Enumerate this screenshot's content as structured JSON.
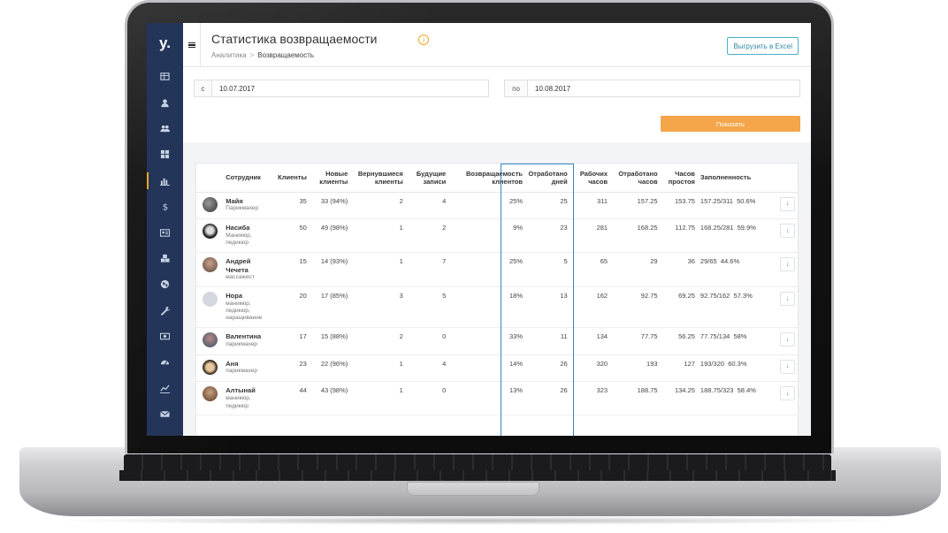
{
  "app": {
    "logo": "y."
  },
  "header": {
    "title": "Статистика возвращаемости",
    "breadcrumb": [
      "Аналитика",
      "Возвращаемость"
    ],
    "breadcrumb_sep": ">",
    "export_button": "Выгрузить в Excel"
  },
  "filters": {
    "from_prefix": "с",
    "from_value": "10.07.2017",
    "to_prefix": "по",
    "to_value": "10.08.2017",
    "show_button": "Показать"
  },
  "sidebar": {
    "items": [
      {
        "icon": "table-icon"
      },
      {
        "icon": "user-icon"
      },
      {
        "icon": "users-icon"
      },
      {
        "icon": "grid-icon"
      },
      {
        "icon": "bar-chart-icon",
        "active": true
      },
      {
        "icon": "dollar-icon"
      },
      {
        "icon": "id-card-icon"
      },
      {
        "icon": "cubes-icon"
      },
      {
        "icon": "globe-icon"
      },
      {
        "icon": "wrench-icon"
      },
      {
        "icon": "money-icon"
      },
      {
        "icon": "dashboard-icon"
      },
      {
        "icon": "line-chart-icon"
      },
      {
        "icon": "mail-icon"
      }
    ]
  },
  "table": {
    "headers": [
      "Сотрудник",
      "Клиенты",
      "Новые клиенты",
      "Вернувшиеся клиенты",
      "Будущие записи",
      "Возвращаемость клиентов",
      "Отработано дней",
      "Рабочих часов",
      "Отработано часов",
      "Часов простоя",
      "Заполненность"
    ],
    "rows": [
      {
        "name": "Майя",
        "role": "Парикмахер",
        "clients": "35",
        "new": "33 (94%)",
        "returned": "2",
        "future": "4",
        "return_rate": "25%",
        "days": "25",
        "work_hours": "311",
        "worked_hours": "157.25",
        "idle": "153.75",
        "fill": "157.25/311",
        "fill_pct": "50.6%"
      },
      {
        "name": "Насиба",
        "role": "Маникюр,\nпедикюр",
        "clients": "50",
        "new": "49 (98%)",
        "returned": "1",
        "future": "2",
        "return_rate": "9%",
        "days": "23",
        "work_hours": "281",
        "worked_hours": "168.25",
        "idle": "112.75",
        "fill": "168.25/281",
        "fill_pct": "59.9%"
      },
      {
        "name": "Андрей\nЧечета",
        "role": "массажист",
        "clients": "15",
        "new": "14 (93%)",
        "returned": "1",
        "future": "7",
        "return_rate": "25%",
        "days": "5",
        "work_hours": "65",
        "worked_hours": "29",
        "idle": "36",
        "fill": "29/65",
        "fill_pct": "44.6%"
      },
      {
        "name": "Нора",
        "role": "маникюр,\nпедикюр,\nнаращивание",
        "clients": "20",
        "new": "17 (85%)",
        "returned": "3",
        "future": "5",
        "return_rate": "18%",
        "days": "13",
        "work_hours": "162",
        "worked_hours": "92.75",
        "idle": "69.25",
        "fill": "92.75/162",
        "fill_pct": "57.3%"
      },
      {
        "name": "Валентина",
        "role": "парикмахер",
        "clients": "17",
        "new": "15 (88%)",
        "returned": "2",
        "future": "0",
        "return_rate": "33%",
        "days": "11",
        "work_hours": "134",
        "worked_hours": "77.75",
        "idle": "56.25",
        "fill": "77.75/134",
        "fill_pct": "58%"
      },
      {
        "name": "Аня",
        "role": "парикмахер",
        "clients": "23",
        "new": "22 (96%)",
        "returned": "1",
        "future": "4",
        "return_rate": "14%",
        "days": "26",
        "work_hours": "320",
        "worked_hours": "193",
        "idle": "127",
        "fill": "193/320",
        "fill_pct": "60.3%"
      },
      {
        "name": "Алтынай",
        "role": "маникюр,\nпедикюр",
        "clients": "44",
        "new": "43 (98%)",
        "returned": "1",
        "future": "0",
        "return_rate": "13%",
        "days": "26",
        "work_hours": "323",
        "worked_hours": "188.75",
        "idle": "134.25",
        "fill": "188.75/323",
        "fill_pct": "58.4%"
      }
    ]
  },
  "colors": {
    "sidebar": "#233659",
    "accent": "#f5a623",
    "show_button": "#f5a54a",
    "highlight": "#3a86c5"
  }
}
